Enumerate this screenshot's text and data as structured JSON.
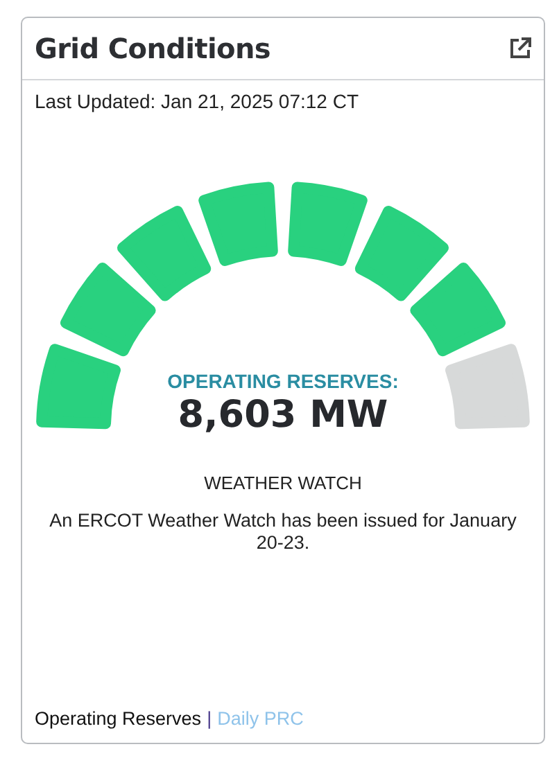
{
  "card": {
    "title": "Grid Conditions",
    "last_updated": "Last Updated: Jan 21, 2025 07:12 CT"
  },
  "gauge": {
    "segments": [
      {
        "filled": true
      },
      {
        "filled": true
      },
      {
        "filled": true
      },
      {
        "filled": true
      },
      {
        "filled": true
      },
      {
        "filled": true
      },
      {
        "filled": true
      },
      {
        "filled": false
      }
    ],
    "label": "OPERATING RESERVES:",
    "value": "8,603 MW"
  },
  "status": {
    "heading": "WEATHER WATCH",
    "message": "An ERCOT Weather Watch has been issued for January 20-23."
  },
  "footer": {
    "current": "Operating Reserves",
    "separator": "|",
    "link": "Daily PRC"
  }
}
